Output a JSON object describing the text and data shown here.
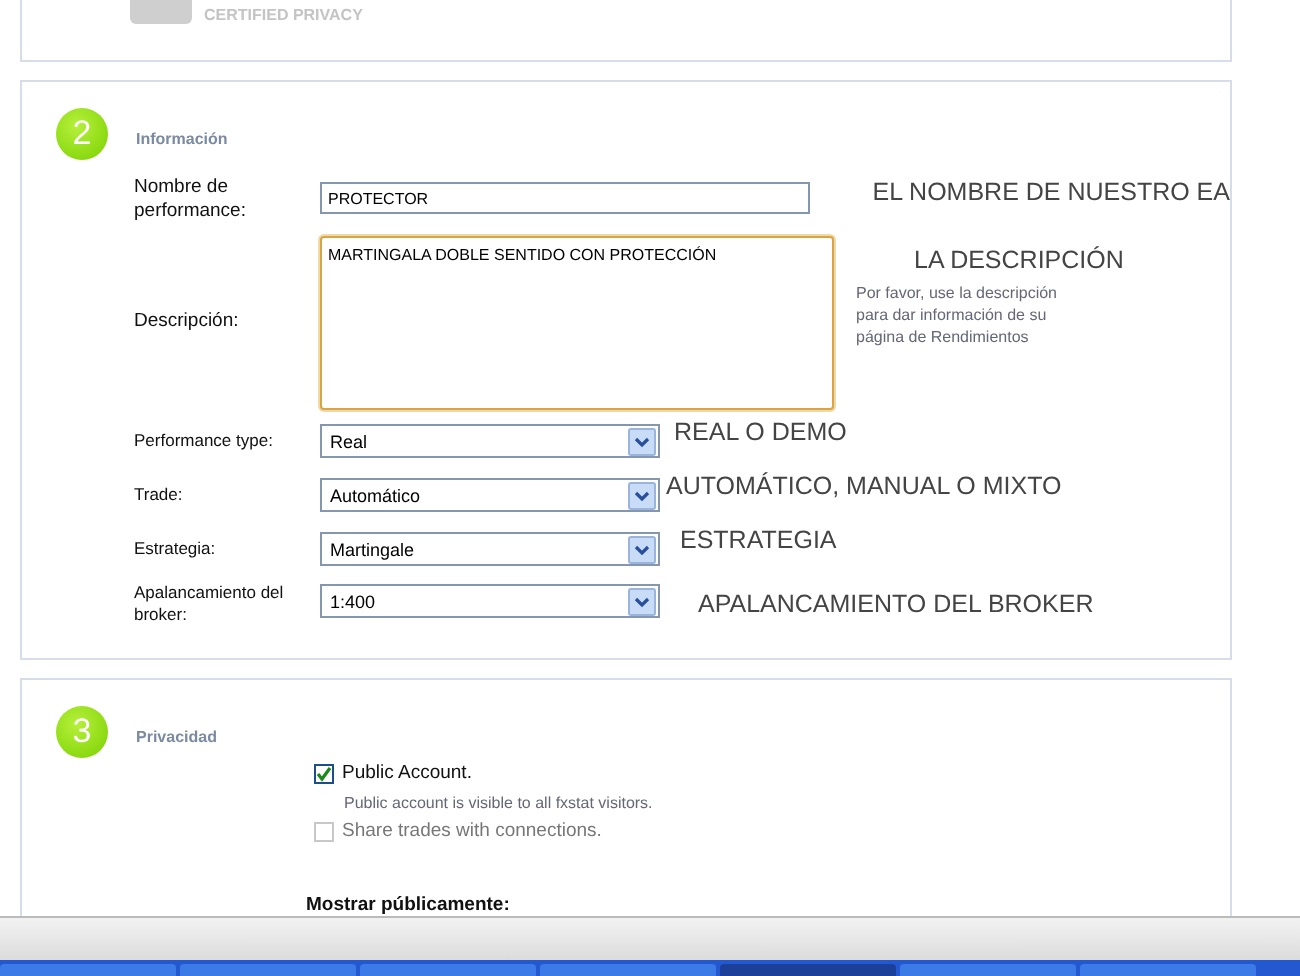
{
  "certified_badge": {
    "label": "CERTIFIED PRIVACY"
  },
  "info_section": {
    "number": "2",
    "title": "Información",
    "fields": [
      {
        "kind": "text",
        "label": "Nombre de performance:",
        "value": "PROTECTOR",
        "focused": false,
        "annotation": "EL NOMBRE DE NUESTRO EA"
      },
      {
        "kind": "textarea",
        "label": "Descripción:",
        "value": "MARTINGALA DOBLE SENTIDO CON PROTECCIÓN",
        "focused": true,
        "annotation": "LA DESCRIPCIÓN",
        "help": "Por favor, use la descripción para dar información de su página de Rendimientos"
      },
      {
        "kind": "select",
        "label": "Performance type:",
        "value": "Real",
        "focused": false,
        "annotation": "REAL O DEMO"
      },
      {
        "kind": "select",
        "label": "Trade:",
        "value": "Automático",
        "focused": false,
        "annotation": "AUTOMÁTICO, MANUAL O MIXTO"
      },
      {
        "kind": "select",
        "label": "Estrategia:",
        "value": "Martingale",
        "focused": false,
        "annotation": "ESTRATEGIA"
      },
      {
        "kind": "select",
        "label": "Apalancamiento del broker:",
        "value": "1:400",
        "focused": false,
        "annotation": "APALANCAMIENTO DEL BROKER"
      }
    ]
  },
  "privacy_section": {
    "number": "3",
    "title": "Privacidad",
    "options": [
      {
        "label": "Public Account.",
        "checked": true,
        "disabled": false,
        "help": "Public account is visible to all fxstat visitors."
      },
      {
        "label": "Share trades with connections.",
        "checked": false,
        "disabled": true
      }
    ],
    "show_publicly_label": "Mostrar públicamente:"
  }
}
